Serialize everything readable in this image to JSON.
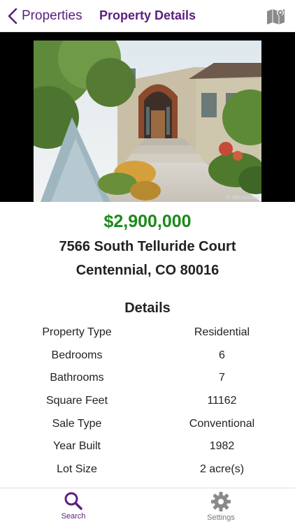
{
  "nav": {
    "back_label": "Properties",
    "title": "Property Details",
    "map_icon": "map-icon"
  },
  "photo": {
    "credit": "© REcolorado"
  },
  "listing": {
    "price": "$2,900,000",
    "address_line1": "7566 South Telluride Court",
    "address_line2": "Centennial, CO 80016"
  },
  "details": {
    "title": "Details",
    "rows": [
      {
        "label": "Property Type",
        "value": "Residential"
      },
      {
        "label": "Bedrooms",
        "value": "6"
      },
      {
        "label": "Bathrooms",
        "value": "7"
      },
      {
        "label": "Square Feet",
        "value": "11162"
      },
      {
        "label": "Sale Type",
        "value": "Conventional"
      },
      {
        "label": "Year Built",
        "value": "1982"
      },
      {
        "label": "Lot Size",
        "value": "2 acre(s)"
      }
    ]
  },
  "tabs": {
    "search_label": "Search",
    "settings_label": "Settings"
  },
  "colors": {
    "brand": "#5b1f7e",
    "price": "#1b8a1b"
  }
}
